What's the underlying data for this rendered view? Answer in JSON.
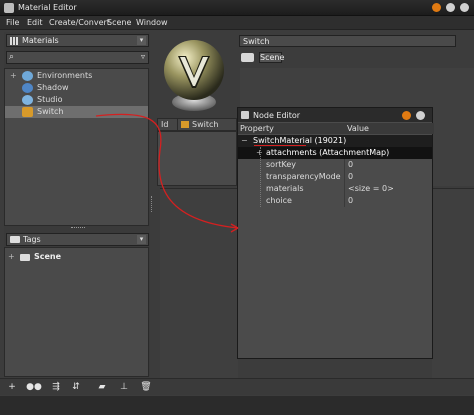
{
  "window": {
    "title": "Material Editor"
  },
  "menu": [
    "File",
    "Edit",
    "Create/Convert",
    "Scene",
    "Window"
  ],
  "materials_panel": {
    "label": "Materials",
    "search_placeholder": "",
    "items": [
      {
        "label": "Environments",
        "icon": "environments-icon",
        "color": "#6fa8d8"
      },
      {
        "label": "Shadow",
        "icon": "shadow-icon",
        "color": "#4f86c6"
      },
      {
        "label": "Studio",
        "icon": "studio-icon",
        "color": "#7fb4e0"
      },
      {
        "label": "Switch",
        "icon": "switch-icon",
        "color": "#d89a2a",
        "selected": true
      }
    ]
  },
  "tags_panel": {
    "label": "Tags",
    "items": [
      {
        "label": "Scene"
      }
    ]
  },
  "material": {
    "name": "Switch",
    "tag": "Scene"
  },
  "list": {
    "columns": [
      "Id",
      "Switch"
    ]
  },
  "node_editor": {
    "title": "Node Editor",
    "columns": [
      "Property",
      "Value"
    ],
    "root": "SwitchMaterial (19021)",
    "rows": [
      {
        "property": "attachments (AttachmentMap)",
        "value": "",
        "expandable": true
      },
      {
        "property": "sortKey",
        "value": "0"
      },
      {
        "property": "transparencyMode",
        "value": "0"
      },
      {
        "property": "materials",
        "value": "<size = 0>"
      },
      {
        "property": "choice",
        "value": "0"
      }
    ]
  },
  "colors": {
    "accent_red": "#d42020",
    "title_orange": "#e07a12"
  }
}
